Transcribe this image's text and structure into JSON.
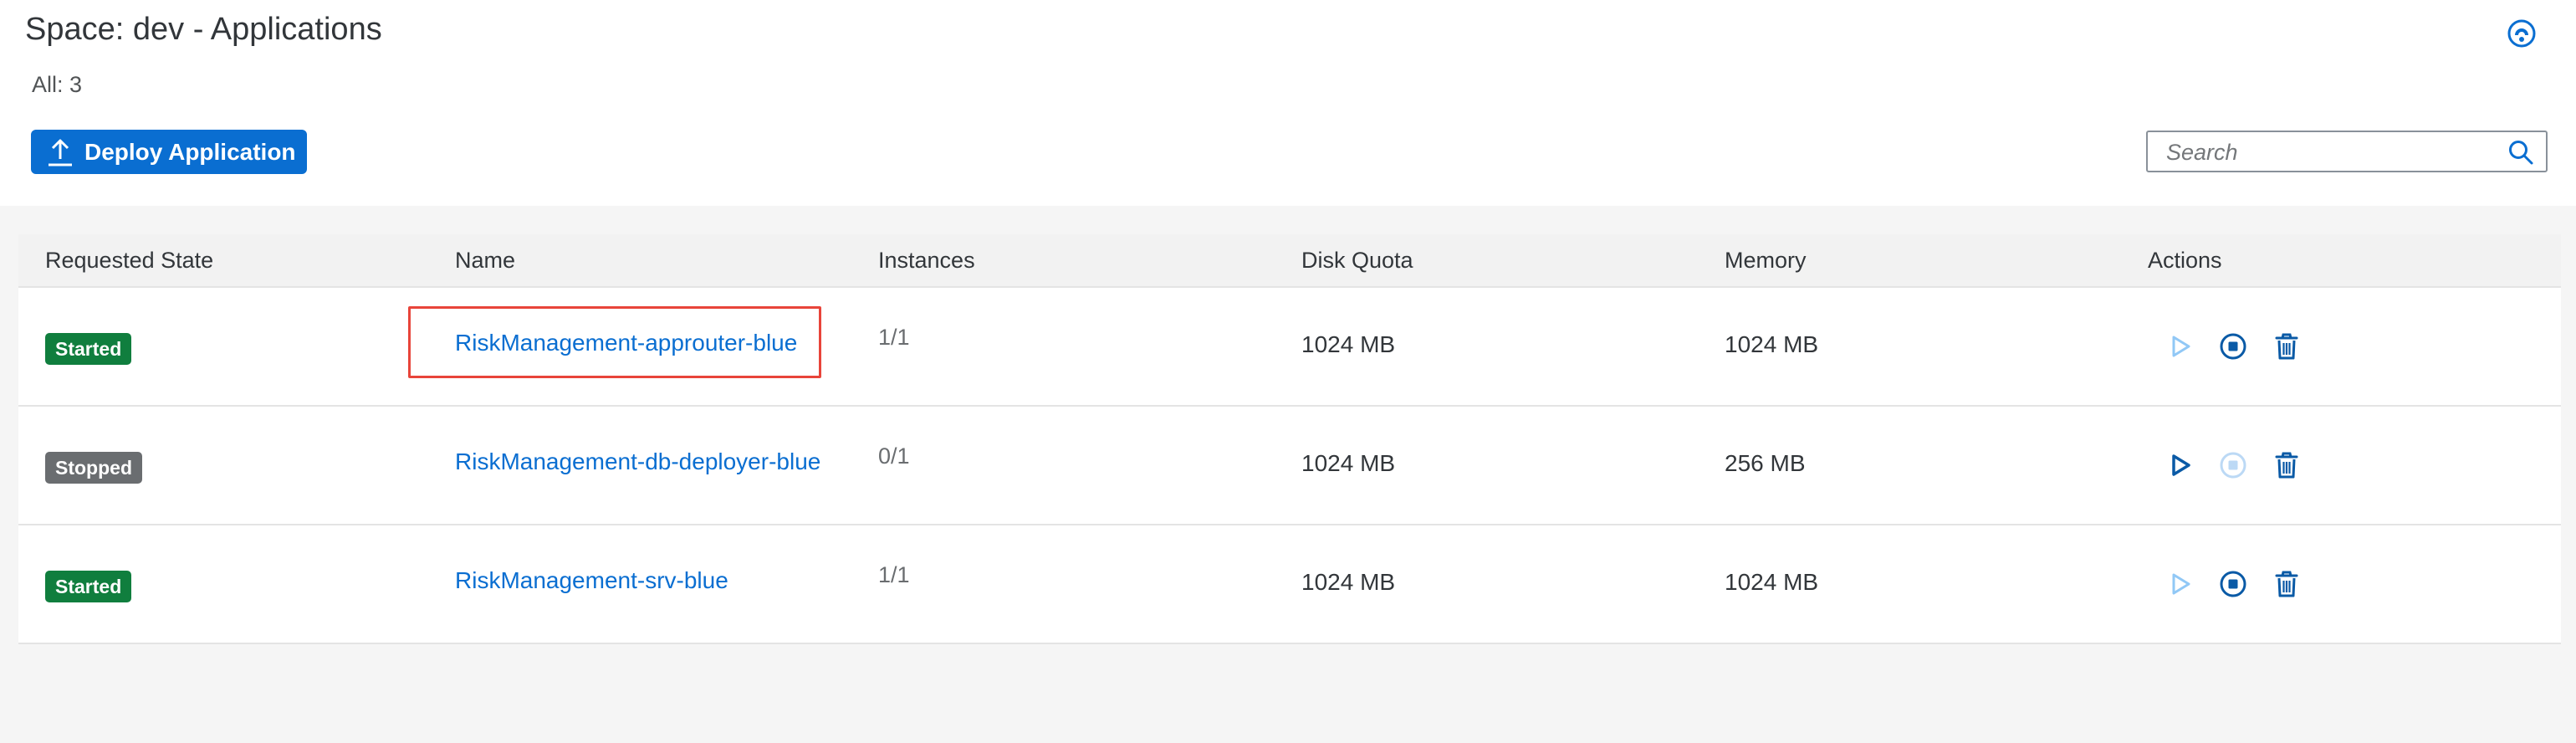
{
  "page": {
    "title": "Space: dev - Applications",
    "count_label": "All: 3"
  },
  "toolbar": {
    "deploy_label": "Deploy Application",
    "deploy_icon": "upload-icon",
    "help_icon": "help-icon"
  },
  "search": {
    "placeholder": "Search",
    "value": "",
    "icon": "search-icon"
  },
  "table": {
    "columns": [
      "Requested State",
      "Name",
      "Instances",
      "Disk Quota",
      "Memory",
      "Actions"
    ],
    "rows": [
      {
        "state": "Started",
        "name": "RiskManagement-approuter-blue",
        "instances": "1/1",
        "disk": "1024 MB",
        "memory": "1024 MB",
        "start_enabled": false,
        "stop_enabled": true,
        "highlighted": true
      },
      {
        "state": "Stopped",
        "name": "RiskManagement-db-deployer-blue",
        "instances": "0/1",
        "disk": "1024 MB",
        "memory": "256 MB",
        "start_enabled": true,
        "stop_enabled": false,
        "highlighted": false
      },
      {
        "state": "Started",
        "name": "RiskManagement-srv-blue",
        "instances": "1/1",
        "disk": "1024 MB",
        "memory": "1024 MB",
        "start_enabled": false,
        "stop_enabled": true,
        "highlighted": false
      }
    ]
  },
  "colors": {
    "accent": "#0a6ed1",
    "started": "#107e3e",
    "stopped": "#6a6d70",
    "highlight": "#e8443a",
    "disabled_icon": "#91c8f6"
  }
}
